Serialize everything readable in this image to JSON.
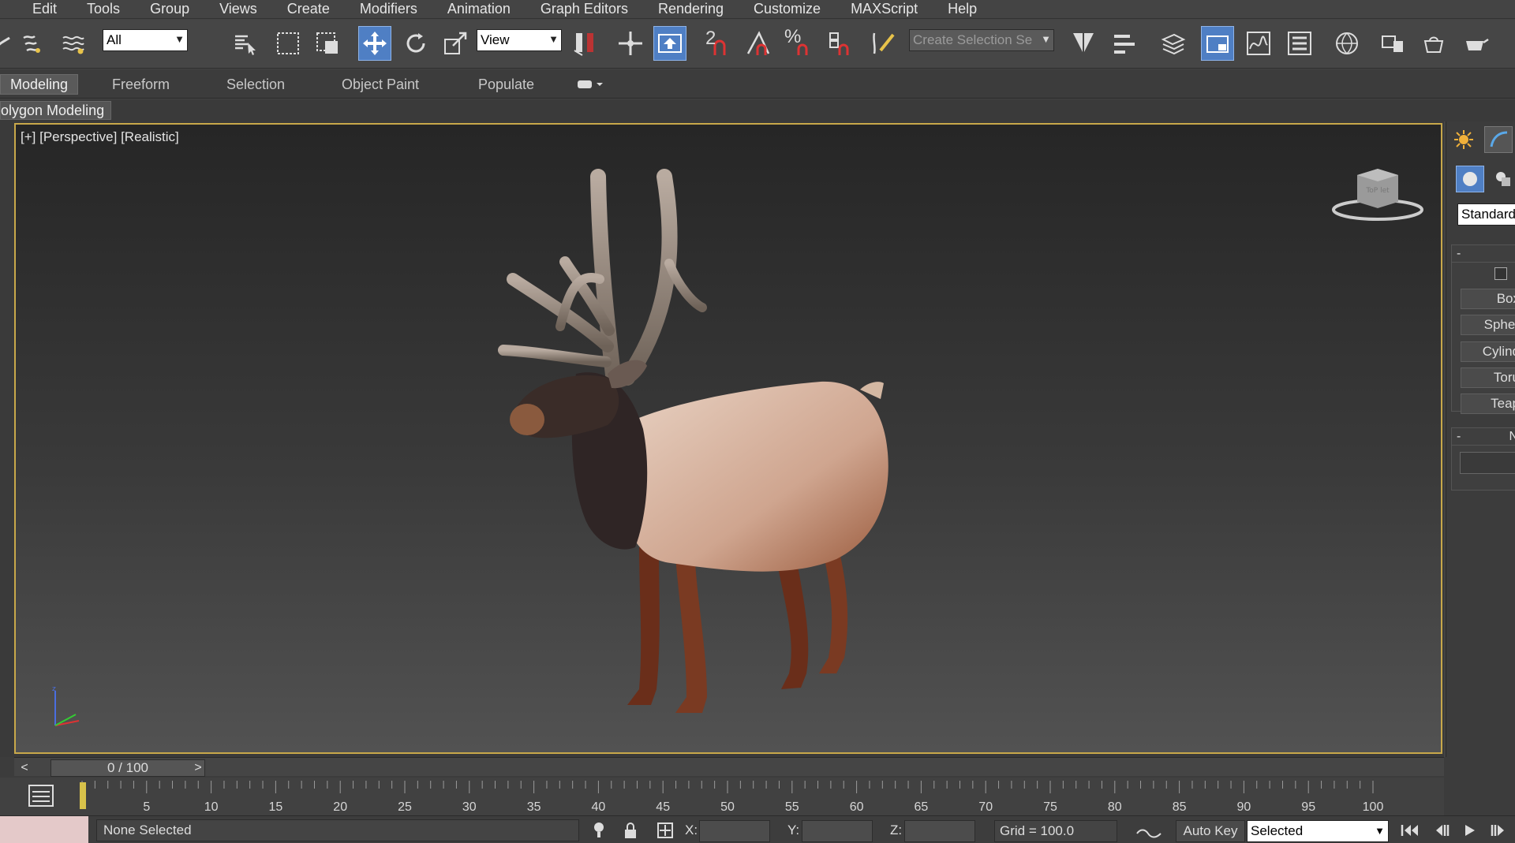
{
  "menu": [
    "Edit",
    "Tools",
    "Group",
    "Views",
    "Create",
    "Modifiers",
    "Animation",
    "Graph Editors",
    "Rendering",
    "Customize",
    "MAXScript",
    "Help"
  ],
  "toolbar": {
    "selection_filter": "All",
    "ref_coord_system": "View",
    "named_selection_placeholder": "Create Selection Se",
    "snap_label": "2"
  },
  "ribbon": {
    "tabs": [
      "Modeling",
      "Freeform",
      "Selection",
      "Object Paint",
      "Populate"
    ],
    "active_tab": "Modeling",
    "sub_tab": "olygon Modeling"
  },
  "viewport": {
    "label": "[+] [Perspective] [Realistic]",
    "border_color": "#c8a84a",
    "cube_top_text": "ToP  let"
  },
  "command_panel": {
    "category": "Standard",
    "rollout1_header": "-",
    "rollout2_header": "-",
    "rollout2_right": "N",
    "objects": [
      "Box",
      "Spher",
      "Cylind",
      "Toru",
      "Teap"
    ]
  },
  "time_slider": {
    "position": "0 / 100",
    "prev": "<",
    "next": ">"
  },
  "track_bar": {
    "ticks": [
      0,
      5,
      10,
      15,
      20,
      25,
      30,
      35,
      40,
      45,
      50,
      55,
      60,
      65,
      70,
      75,
      80,
      85,
      90,
      95,
      100
    ],
    "labels": [
      "5",
      "10",
      "15",
      "20",
      "25",
      "30",
      "35",
      "40",
      "45",
      "50",
      "55",
      "60",
      "65",
      "70",
      "75",
      "80",
      "85",
      "90",
      "95",
      "100"
    ]
  },
  "status": {
    "selection_text": "None Selected",
    "x_label": "X:",
    "y_label": "Y:",
    "z_label": "Z:",
    "grid": "Grid = 100.0",
    "auto_key": "Auto Key",
    "key_filter": "Selected"
  },
  "colors": {
    "active_blue": "#4f7fc4",
    "viewport_border": "#c8a84a",
    "listener_pink": "#e4c9c9"
  }
}
